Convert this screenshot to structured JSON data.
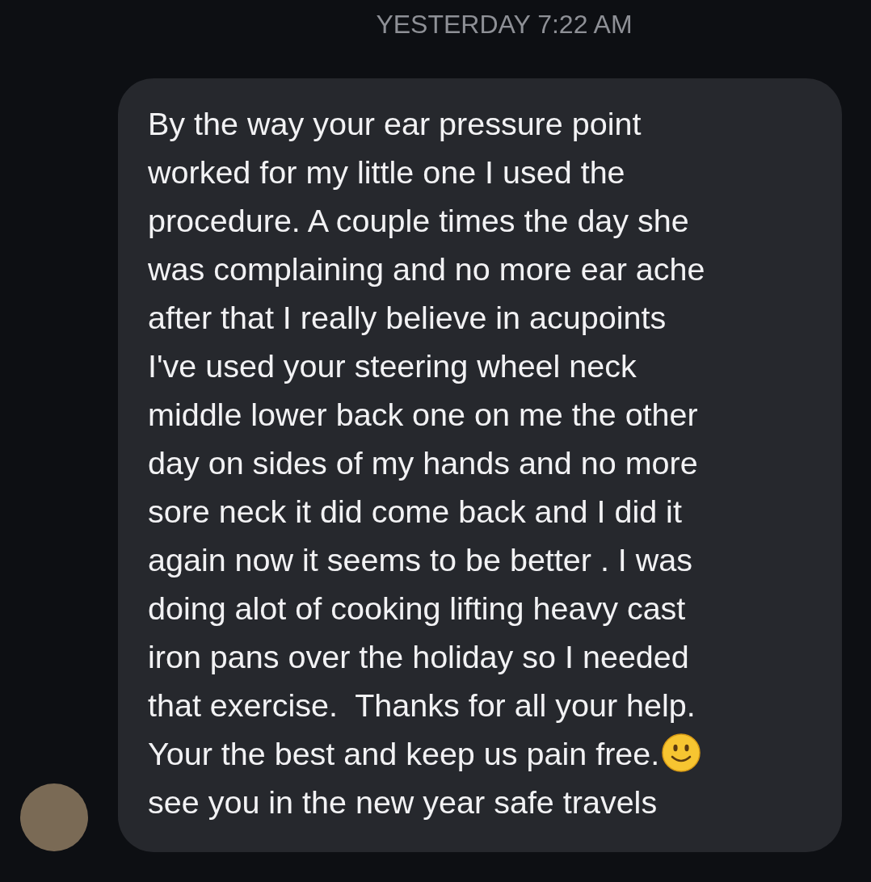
{
  "timestamp": "YESTERDAY 7:22 AM",
  "message": {
    "lines": [
      "By the way your ear pressure point",
      "worked for my little one I used the",
      "procedure. A couple times the day she",
      "was complaining and no more ear ache",
      "after that I really believe in acupoints",
      "I've used your steering wheel neck",
      "middle lower back one on me the other",
      "day on sides of my hands and no more",
      "sore neck it did come back and I did it",
      "again now it seems to be better . I was",
      "doing alot of cooking lifting heavy cast",
      "iron pans over the holiday so I needed",
      "that exercise.  Thanks for all your help.",
      "Your the best and keep us pain free."
    ],
    "last_line": "see you in the new year safe travels"
  }
}
